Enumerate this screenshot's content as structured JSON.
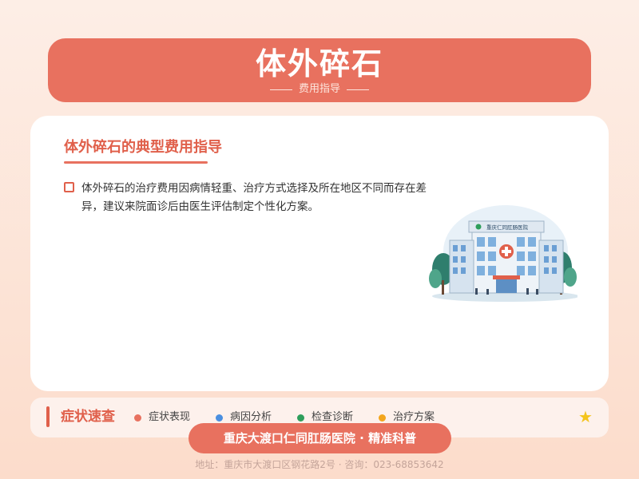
{
  "header": {
    "title": "体外碎石",
    "subtitle": "费用指导"
  },
  "card": {
    "title": "体外碎石的典型费用指导",
    "text": "体外碎石的治疗费用因病情轻重、治疗方式选择及所在地区不同而存在差异，建议来院面诊后由医生评估制定个性化方案。",
    "hospital_sign": "重庆仁同肛肠医院"
  },
  "quickbar": {
    "title": "症状速查",
    "items": [
      {
        "label": "症状表现",
        "color": "#e8715f"
      },
      {
        "label": "病因分析",
        "color": "#4a8fe0"
      },
      {
        "label": "检查诊断",
        "color": "#2e9e5b"
      },
      {
        "label": "治疗方案",
        "color": "#f3a51c"
      }
    ],
    "star": "★"
  },
  "brand": {
    "pill": "重庆大渡口仁同肛肠医院 · 精准科普"
  },
  "footer": {
    "text": "地址：重庆市大渡口区钢花路2号 · 咨询：023-68853642"
  }
}
